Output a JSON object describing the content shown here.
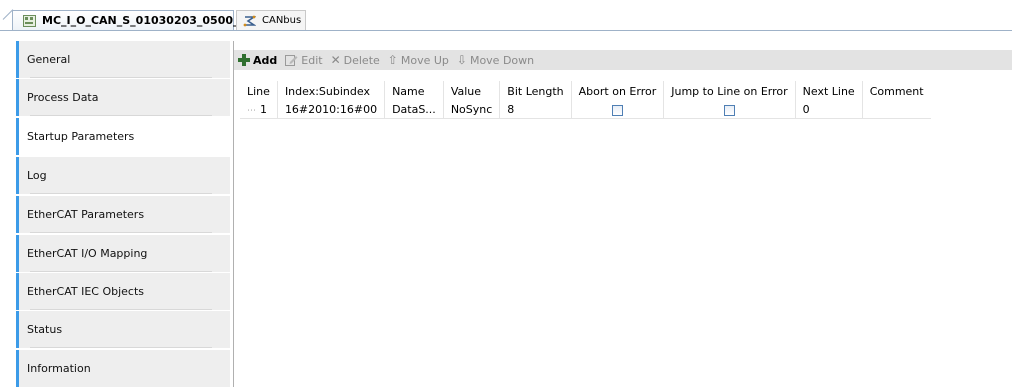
{
  "tabs": [
    {
      "label": "MC_I_O_CAN_S_01030203_0500_",
      "close": "x",
      "icon": "device-icon",
      "active": true
    },
    {
      "label": "CANbus",
      "icon": "canbus-icon",
      "active": false
    }
  ],
  "sidebar": {
    "items": [
      {
        "label": "General"
      },
      {
        "label": "Process Data"
      },
      {
        "label": "Startup Parameters",
        "active": true
      },
      {
        "label": "Log"
      },
      {
        "label": "EtherCAT Parameters"
      },
      {
        "label": "EtherCAT I/O Mapping"
      },
      {
        "label": "EtherCAT IEC Objects"
      },
      {
        "label": "Status"
      },
      {
        "label": "Information"
      }
    ]
  },
  "toolbar": {
    "add": "Add",
    "edit": "Edit",
    "delete": "Delete",
    "move_up": "Move Up",
    "move_down": "Move Down"
  },
  "table": {
    "columns": [
      "Line",
      "Index:Subindex",
      "Name",
      "Value",
      "Bit Length",
      "Abort on Error",
      "Jump to Line on Error",
      "Next Line",
      "Comment"
    ],
    "rows": [
      {
        "line": "1",
        "index": "16#2010:16#00",
        "name": "DataS...",
        "value": "NoSync",
        "bit_length": "8",
        "abort_on_error": false,
        "jump_on_error": false,
        "next_line": "0",
        "comment": ""
      }
    ]
  },
  "colors": {
    "accent": "#3c9be8",
    "toolbar_bg": "#e3e3e3",
    "nav_bg": "#eeeeee"
  }
}
